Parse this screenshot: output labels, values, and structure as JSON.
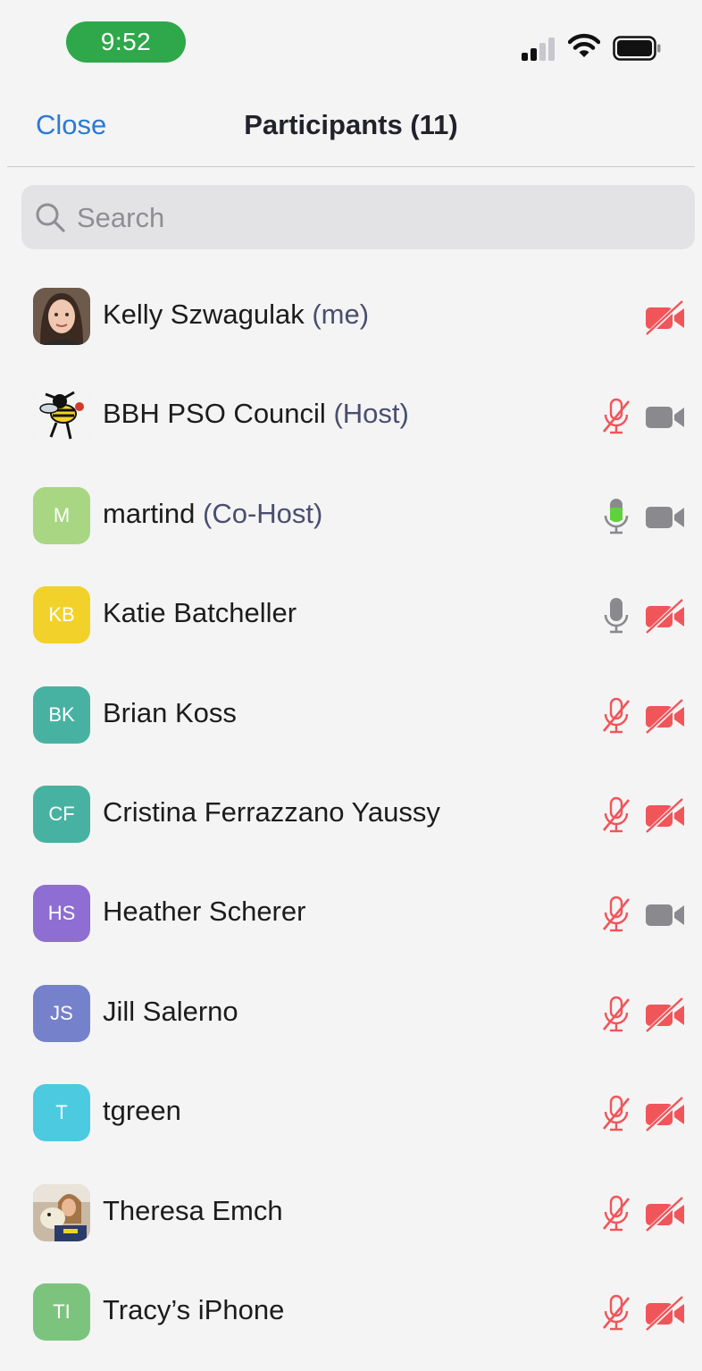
{
  "status_bar": {
    "time": "9:52",
    "accent_color": "#2ea84a"
  },
  "nav": {
    "close_label": "Close",
    "title": "Participants (11)",
    "link_color": "#2a7ad6"
  },
  "search": {
    "placeholder": "Search",
    "value": ""
  },
  "colors": {
    "muted_red": "#f0555a",
    "gray_icon": "#8a8a8e",
    "talking_green": "#5ed13c"
  },
  "participants": [
    {
      "name": "Kelly Szwagulak",
      "role": "(me)",
      "avatar_type": "photo",
      "avatar_icon": "woman-portrait-photo",
      "initials": "",
      "avatar_color": "#8a6a5a",
      "mic": "none",
      "video": "off"
    },
    {
      "name": "BBH PSO Council",
      "role": "(Host)",
      "avatar_type": "photo",
      "avatar_icon": "hornet-mascot-logo",
      "initials": "",
      "avatar_color": "#f4f4f4",
      "mic": "muted",
      "video": "on"
    },
    {
      "name": "martind",
      "role": "(Co-Host)",
      "avatar_type": "initials",
      "initials": "M",
      "avatar_color": "#a8d683",
      "mic": "talking",
      "video": "on"
    },
    {
      "name": "Katie Batcheller",
      "role": "",
      "avatar_type": "initials",
      "initials": "KB",
      "avatar_color": "#f2d22a",
      "mic": "on",
      "video": "off"
    },
    {
      "name": "Brian Koss",
      "role": "",
      "avatar_type": "initials",
      "initials": "BK",
      "avatar_color": "#48b2a2",
      "mic": "muted",
      "video": "off"
    },
    {
      "name": "Cristina Ferrazzano Yaussy",
      "role": "",
      "avatar_type": "initials",
      "initials": "CF",
      "avatar_color": "#48b2a2",
      "mic": "muted",
      "video": "off"
    },
    {
      "name": "Heather Scherer",
      "role": "",
      "avatar_type": "initials",
      "initials": "HS",
      "avatar_color": "#8e6ed2",
      "mic": "muted",
      "video": "on"
    },
    {
      "name": "Jill Salerno",
      "role": "",
      "avatar_type": "initials",
      "initials": "JS",
      "avatar_color": "#7681cc",
      "mic": "muted",
      "video": "off"
    },
    {
      "name": "tgreen",
      "role": "",
      "avatar_type": "initials",
      "initials": "T",
      "avatar_color": "#4ccae0",
      "mic": "muted",
      "video": "off"
    },
    {
      "name": "Theresa Emch",
      "role": "",
      "avatar_type": "photo",
      "avatar_icon": "woman-with-dog-photo",
      "initials": "",
      "avatar_color": "#b9987a",
      "mic": "muted",
      "video": "off"
    },
    {
      "name": "Tracy’s iPhone",
      "role": "",
      "avatar_type": "initials",
      "initials": "TI",
      "avatar_color": "#7cc47e",
      "mic": "muted",
      "video": "off"
    }
  ]
}
